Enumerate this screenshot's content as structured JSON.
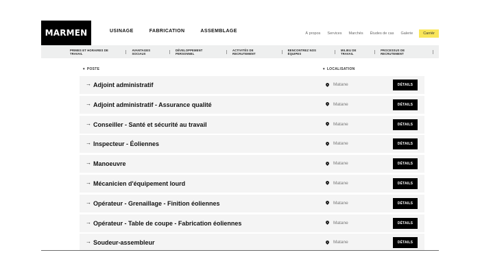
{
  "brand": {
    "logo_text": "MARMEN"
  },
  "main_nav": [
    "USINAGE",
    "FABRICATION",
    "ASSEMBLAGE"
  ],
  "secondary_nav": [
    "À propos",
    "Services",
    "Marchés",
    "Études de cas",
    "Galerie"
  ],
  "career_label": "Carrièr",
  "sub_nav": [
    "PRIMES ET HORAIRES DE TRAVAIL",
    "AVANTAGES SOCIAUX",
    "DÉVELOPPEMENT PERSONNEL",
    "ACTIVITÉS DE RECRUTEMENT",
    "RENCONTREZ NOS ÉQUIPES",
    "MILIEU DE TRAVAIL",
    "PROCESSUS DE RECRUTEMENT"
  ],
  "columns": {
    "post": "POSTE",
    "location": "LOCALISATION"
  },
  "details_label": "DÉTAILS",
  "jobs": [
    {
      "title": "Adjoint administratif",
      "location": "Matane"
    },
    {
      "title": "Adjoint administratif - Assurance qualité",
      "location": "Matane"
    },
    {
      "title": "Conseiller - Santé et sécurité au travail",
      "location": "Matane"
    },
    {
      "title": "Inspecteur - Éoliennes",
      "location": "Matane"
    },
    {
      "title": "Manoeuvre",
      "location": "Matane"
    },
    {
      "title": "Mécanicien d'équipement lourd",
      "location": "Matane"
    },
    {
      "title": "Opérateur - Grenaillage - Finition éoliennes",
      "location": "Matane"
    },
    {
      "title": "Opérateur - Table de coupe - Fabrication éoliennes",
      "location": "Matane"
    },
    {
      "title": "Soudeur-assembleur",
      "location": "Matane"
    }
  ]
}
